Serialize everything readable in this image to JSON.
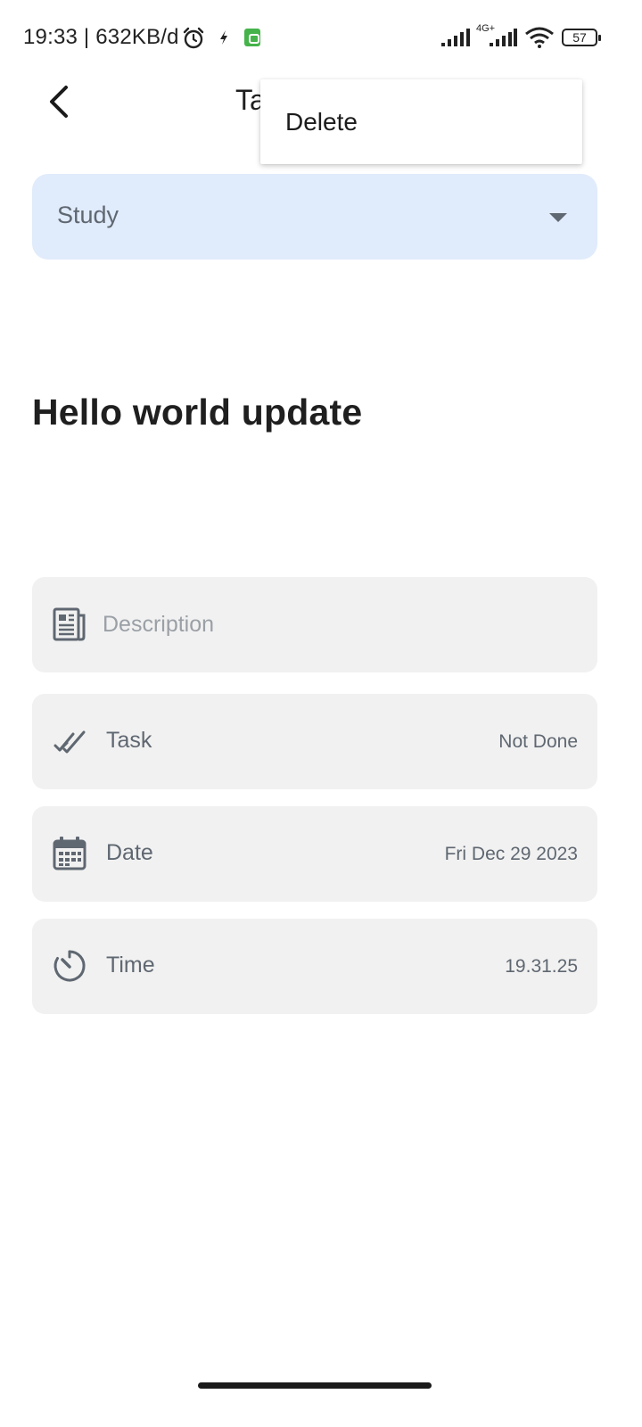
{
  "status_bar": {
    "time_text": "19:33 | 632KB/d",
    "network_label": "4G+",
    "battery_level": "57",
    "icons": [
      "alarm-icon",
      "bolt-icon",
      "app-badge-icon",
      "signal-icon",
      "signal-4g-icon",
      "wifi-icon",
      "battery-icon"
    ]
  },
  "app_bar": {
    "title_partial": "Ta",
    "back_icon": "chevron-left-icon"
  },
  "menu": {
    "items": [
      {
        "label": "Delete"
      }
    ]
  },
  "category": {
    "value": "Study",
    "icon": "caret-down-icon"
  },
  "task": {
    "title": "Hello world update"
  },
  "fields": {
    "description": {
      "placeholder": "Description",
      "icon": "article-icon"
    },
    "status": {
      "label": "Task",
      "value": "Not Done",
      "icon": "double-check-icon"
    },
    "date": {
      "label": "Date",
      "value": "Fri Dec 29 2023",
      "icon": "calendar-icon"
    },
    "time": {
      "label": "Time",
      "value": "19.31.25",
      "icon": "timer-icon"
    }
  },
  "colors": {
    "accent_light": "#e0ebfb",
    "card_bg": "#f1f1f1",
    "muted_text": "#5f6771",
    "placeholder_text": "#9aa0a6"
  }
}
